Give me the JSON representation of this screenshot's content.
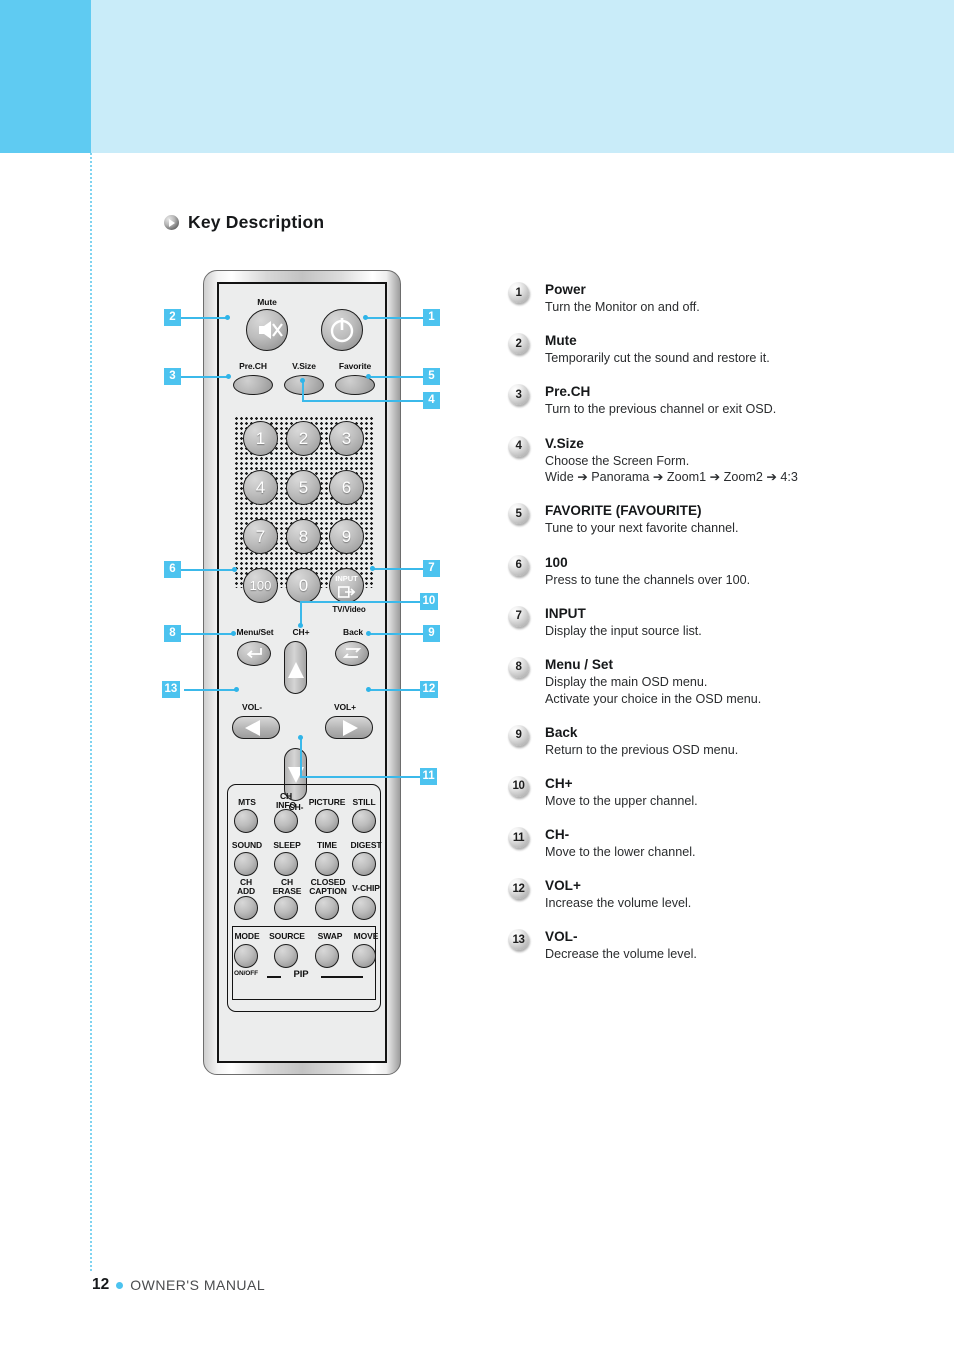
{
  "page": {
    "section_title": "Key Description",
    "footer_page_number": "12",
    "footer_label": "OWNER'S MANUAL",
    "accent_color": "#4cc3ef",
    "header_band_color": "#c9ecf9",
    "header_strip_color": "#5fcbf2"
  },
  "remote": {
    "labels": {
      "mute": "Mute",
      "prech": "Pre.CH",
      "vsize": "V.Size",
      "favorite": "Favorite",
      "hundred": "100",
      "zero": "0",
      "input": "INPUT",
      "tv_video": "TV/Video",
      "menu_set": "Menu/Set",
      "ch_plus": "CH+",
      "back": "Back",
      "vol_minus": "VOL-",
      "vol_plus": "VOL+",
      "ch_minus": "CH-",
      "pip": "PIP",
      "on_off": "ON/OFF"
    },
    "number_keys": [
      "1",
      "2",
      "3",
      "4",
      "5",
      "6",
      "7",
      "8",
      "9"
    ],
    "function_keys": [
      "MTS",
      "CH\nINFO",
      "PICTURE",
      "STILL",
      "SOUND",
      "SLEEP",
      "TIME",
      "DIGEST",
      "CH\nADD",
      "CH\nERASE",
      "CLOSED\nCAPTION",
      "V-CHIP"
    ],
    "pip_keys": [
      "MODE",
      "SOURCE",
      "SWAP",
      "MOVE"
    ],
    "callouts_left": [
      "2",
      "3",
      "6",
      "8",
      "13"
    ],
    "callouts_right": [
      "1",
      "5",
      "4",
      "7",
      "10",
      "9",
      "12",
      "11"
    ]
  },
  "descriptions": [
    {
      "num": "1",
      "title": "Power",
      "lines": [
        "Turn the Monitor on and off."
      ]
    },
    {
      "num": "2",
      "title": "Mute",
      "lines": [
        "Temporarily cut the sound and restore it."
      ]
    },
    {
      "num": "3",
      "title": "Pre.CH",
      "lines": [
        "Turn to the previous channel or exit OSD."
      ]
    },
    {
      "num": "4",
      "title": "V.Size",
      "lines": [
        "Choose the Screen Form.",
        "Wide ➔ Panorama ➔ Zoom1 ➔ Zoom2 ➔ 4:3"
      ]
    },
    {
      "num": "5",
      "title": "FAVORITE (FAVOURITE)",
      "lines": [
        "Tune to your next favorite channel."
      ]
    },
    {
      "num": "6",
      "title": "100",
      "lines": [
        "Press to tune the channels over 100."
      ]
    },
    {
      "num": "7",
      "title": "INPUT",
      "lines": [
        "Display the input source list."
      ]
    },
    {
      "num": "8",
      "title": "Menu / Set",
      "lines": [
        "Display the main OSD menu.",
        "Activate your choice in the OSD menu."
      ]
    },
    {
      "num": "9",
      "title": "Back",
      "lines": [
        "Return to the previous OSD menu."
      ]
    },
    {
      "num": "10",
      "title": "CH+",
      "lines": [
        "Move to the upper channel."
      ]
    },
    {
      "num": "11",
      "title": "CH-",
      "lines": [
        "Move to the lower channel."
      ]
    },
    {
      "num": "12",
      "title": "VOL+",
      "lines": [
        "Increase the volume level."
      ]
    },
    {
      "num": "13",
      "title": "VOL-",
      "lines": [
        "Decrease the volume level."
      ]
    }
  ]
}
